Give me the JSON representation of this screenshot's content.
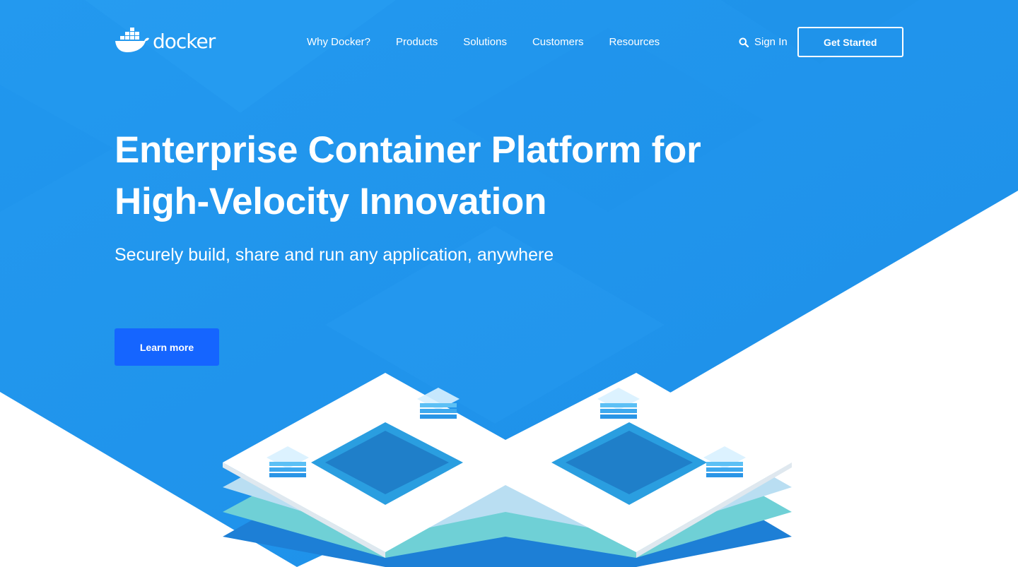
{
  "brand": {
    "name": "docker",
    "colors": {
      "hero_blue": "#2496ed",
      "button_blue": "#1565ff",
      "white": "#ffffff"
    }
  },
  "nav": {
    "links": [
      "Why Docker?",
      "Products",
      "Solutions",
      "Customers",
      "Resources"
    ],
    "search_icon": "search-icon",
    "signin_label": "Sign In",
    "cta_label": "Get Started"
  },
  "hero": {
    "headline_line1": "Enterprise Container Platform for",
    "headline_line2": "High-Velocity Innovation",
    "subheadline": "Securely build, share and run any application, anywhere",
    "button_label": "Learn more"
  }
}
